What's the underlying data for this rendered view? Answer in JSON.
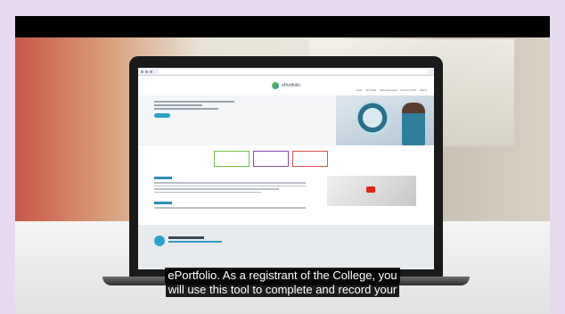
{
  "screen": {
    "site_title": "ePortfolio",
    "nav_items": [
      "Home",
      "My Profile",
      "Self-Assessment",
      "Record of CPD",
      "Submit"
    ],
    "video_icon": "youtube-play-icon",
    "footer_brand": "CMRITO"
  },
  "captions": {
    "line1": "ePortfolio. As a registrant of the College, you",
    "line2": "will use this tool to complete and record your"
  },
  "colors": {
    "background": "#e6dbee",
    "caption_bg": "#000000",
    "caption_text": "#ffffff",
    "accent": "#29a3c9"
  }
}
